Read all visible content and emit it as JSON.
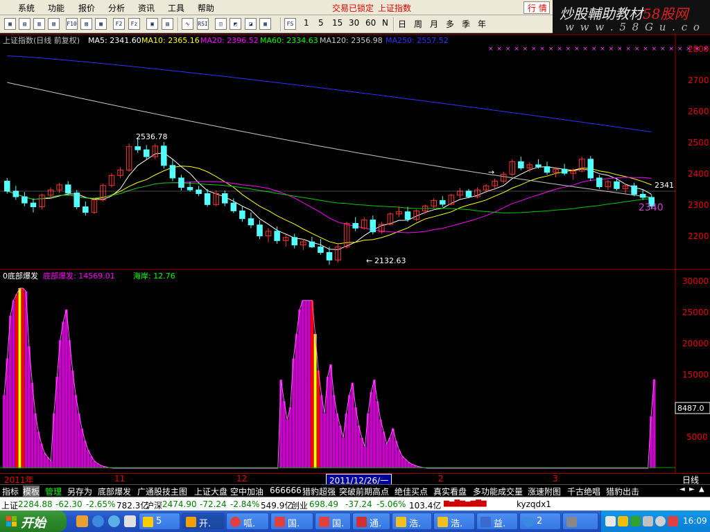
{
  "menu": {
    "items": [
      "系统",
      "功能",
      "报价",
      "分析",
      "资讯",
      "工具",
      "帮助"
    ],
    "status_locked": "交易已锁定",
    "status_index": "上证指数",
    "trade_label": "行 情"
  },
  "logo": {
    "text_main": "炒股輔助教材",
    "text_red": "58股网",
    "url": "w w w . 5 8 G u . c o m"
  },
  "toolbar": {
    "icons": [
      "tb-1",
      "tb-2",
      "tb-3",
      "tb-4",
      "tb-f10",
      "tb-6",
      "tb-7",
      "tb-8",
      "tb-9",
      "tb-10",
      "tb-11",
      "tb-rsi",
      "tb-13",
      "tb-14",
      "tb-15",
      "tb-fs"
    ],
    "icon_labels": [
      "",
      "",
      "",
      "",
      "F10",
      "",
      "",
      "F2",
      "Fz",
      "",
      "",
      "RSI",
      "",
      "",
      "",
      "FS"
    ],
    "periods": [
      "1",
      "5",
      "15",
      "30",
      "60",
      "N",
      "日",
      "周",
      "月",
      "多",
      "季",
      "年"
    ]
  },
  "price_panel": {
    "title": "上证指数(日线 前复权)",
    "ma5_label": "MA5: 2341.60",
    "ma10_label": "MA10: 2365.16",
    "ma20_label": "MA20: 2396.52",
    "ma60_label": "MA60: 2334.63",
    "ma120_label": "MA120: 2356.98",
    "ma250_label": "MA250: 2557.52",
    "high_marker": "2536.78",
    "low_marker": "2132.63",
    "right_marker": "2341",
    "cursor_value": "2340",
    "axis_ticks": [
      "2800",
      "2700",
      "2600",
      "2500",
      "2400",
      "2300",
      "2200"
    ]
  },
  "indicator_panel": {
    "title": "0底部爆发",
    "value_label": "底部爆发: 14569.01",
    "sea_label": "海岸: 12.76",
    "axis_ticks": [
      "30000",
      "25000",
      "20000",
      "15000",
      "5000"
    ],
    "cursor_value": "8487.0"
  },
  "datebar": {
    "labels": [
      "2011年",
      "11",
      "12",
      "2",
      "3"
    ],
    "cursor_date": "2011/12/26/一",
    "period": "日线"
  },
  "formula_tabs": {
    "items": [
      "指标",
      "模板",
      "管理",
      "另存为",
      "底部爆发",
      "广通股技主图",
      "上证大盘",
      "空中加油",
      "666666",
      "猎豹超强",
      "突破前期高点",
      "绝佳买点",
      "真实看盘",
      "多功能成交量",
      "涨速附图",
      "千古绝唱",
      "猎豹出击"
    ]
  },
  "ticker": {
    "sh_label": "上证",
    "sh_value": "2284.88",
    "sh_change": "-62.30",
    "sh_pct": "-2.65%",
    "sh_amount": "782.3亿",
    "hs_label": "沪深",
    "hs_value": "2474.90",
    "hs_change": "-72.24",
    "hs_pct": "-2.84%",
    "hs_amount": "549.9亿",
    "cy_label": "创业",
    "cy_value": "698.49",
    "cy_change": "-37.24",
    "cy_pct": "-5.06%",
    "cy_amount": "103.4亿",
    "ime": "kyzqdx1"
  },
  "taskbar": {
    "start_label": "开始",
    "tasks": [
      "5",
      "开.",
      "呱.",
      "国.",
      "国.",
      "通.",
      "浩.",
      "浩.",
      "益.",
      "2"
    ],
    "clock": "16:09"
  },
  "colors": {
    "up": "#ff3333",
    "down": "#54ffff",
    "ma5": "#ffffff",
    "ma10": "#ffff00",
    "ma20": "#ff00ff",
    "ma60": "#00cc00",
    "ma120": "#c8c8c8",
    "ma250": "#3030ff",
    "hist": "#cc00cc",
    "hist_peak": "#ffff00",
    "hist_peak_red": "#ff0000"
  },
  "chart_data": {
    "type": "candlestick",
    "title": "上证指数(日线 前复权)",
    "ylim": [
      2140,
      2830
    ],
    "x_labels": [
      "2011年",
      "11",
      "12",
      "2011/12/26",
      "2",
      "3"
    ],
    "ma_series": [
      {
        "name": "MA5",
        "last": 2341.6
      },
      {
        "name": "MA10",
        "last": 2365.16
      },
      {
        "name": "MA20",
        "last": 2396.52
      },
      {
        "name": "MA60",
        "last": 2334.63
      },
      {
        "name": "MA120",
        "last": 2356.98
      },
      {
        "name": "MA250",
        "last": 2557.52
      }
    ],
    "ohlc": [
      [
        2400,
        2410,
        2360,
        2368
      ],
      [
        2368,
        2385,
        2340,
        2350
      ],
      [
        2350,
        2365,
        2320,
        2330
      ],
      [
        2330,
        2345,
        2300,
        2318
      ],
      [
        2318,
        2360,
        2310,
        2355
      ],
      [
        2355,
        2380,
        2345,
        2372
      ],
      [
        2372,
        2395,
        2362,
        2388
      ],
      [
        2388,
        2400,
        2355,
        2362
      ],
      [
        2362,
        2372,
        2310,
        2318
      ],
      [
        2318,
        2335,
        2290,
        2300
      ],
      [
        2300,
        2345,
        2295,
        2340
      ],
      [
        2340,
        2392,
        2335,
        2386
      ],
      [
        2386,
        2425,
        2380,
        2418
      ],
      [
        2418,
        2445,
        2410,
        2435
      ],
      [
        2435,
        2520,
        2430,
        2510
      ],
      [
        2510,
        2537,
        2490,
        2500
      ],
      [
        2500,
        2515,
        2470,
        2478
      ],
      [
        2478,
        2520,
        2470,
        2512
      ],
      [
        2512,
        2525,
        2440,
        2450
      ],
      [
        2450,
        2470,
        2400,
        2410
      ],
      [
        2410,
        2420,
        2370,
        2380
      ],
      [
        2380,
        2398,
        2366,
        2372
      ],
      [
        2372,
        2385,
        2352,
        2360
      ],
      [
        2360,
        2375,
        2318,
        2325
      ],
      [
        2325,
        2370,
        2320,
        2360
      ],
      [
        2360,
        2370,
        2320,
        2330
      ],
      [
        2330,
        2345,
        2298,
        2305
      ],
      [
        2305,
        2320,
        2270,
        2280
      ],
      [
        2280,
        2300,
        2250,
        2260
      ],
      [
        2260,
        2275,
        2215,
        2225
      ],
      [
        2225,
        2250,
        2205,
        2240
      ],
      [
        2240,
        2255,
        2200,
        2210
      ],
      [
        2210,
        2230,
        2190,
        2220
      ],
      [
        2220,
        2232,
        2185,
        2196
      ],
      [
        2196,
        2215,
        2180,
        2206
      ],
      [
        2206,
        2222,
        2186,
        2190
      ],
      [
        2190,
        2215,
        2165,
        2172
      ],
      [
        2172,
        2190,
        2133,
        2148
      ],
      [
        2148,
        2200,
        2140,
        2190
      ],
      [
        2190,
        2270,
        2185,
        2265
      ],
      [
        2265,
        2285,
        2240,
        2250
      ],
      [
        2250,
        2285,
        2245,
        2276
      ],
      [
        2276,
        2290,
        2230,
        2238
      ],
      [
        2238,
        2270,
        2232,
        2262
      ],
      [
        2262,
        2300,
        2258,
        2295
      ],
      [
        2295,
        2320,
        2285,
        2302
      ],
      [
        2302,
        2318,
        2270,
        2278
      ],
      [
        2278,
        2310,
        2272,
        2305
      ],
      [
        2305,
        2325,
        2295,
        2320
      ],
      [
        2320,
        2345,
        2312,
        2338
      ],
      [
        2338,
        2352,
        2318,
        2326
      ],
      [
        2326,
        2360,
        2322,
        2355
      ],
      [
        2355,
        2378,
        2345,
        2368
      ],
      [
        2368,
        2375,
        2345,
        2350
      ],
      [
        2350,
        2380,
        2345,
        2372
      ],
      [
        2372,
        2390,
        2362,
        2385
      ],
      [
        2385,
        2408,
        2372,
        2400
      ],
      [
        2400,
        2430,
        2392,
        2422
      ],
      [
        2422,
        2470,
        2415,
        2462
      ],
      [
        2462,
        2478,
        2435,
        2442
      ],
      [
        2442,
        2460,
        2428,
        2452
      ],
      [
        2452,
        2470,
        2440,
        2446
      ],
      [
        2446,
        2462,
        2420,
        2428
      ],
      [
        2428,
        2445,
        2412,
        2438
      ],
      [
        2438,
        2455,
        2418,
        2425
      ],
      [
        2425,
        2440,
        2405,
        2432
      ],
      [
        2432,
        2478,
        2428,
        2470
      ],
      [
        2470,
        2480,
        2400,
        2410
      ],
      [
        2410,
        2420,
        2375,
        2382
      ],
      [
        2382,
        2405,
        2372,
        2398
      ],
      [
        2398,
        2410,
        2370,
        2376
      ],
      [
        2376,
        2392,
        2360,
        2385
      ],
      [
        2385,
        2395,
        2352,
        2358
      ],
      [
        2358,
        2372,
        2340,
        2348
      ],
      [
        2348,
        2356,
        2310,
        2320
      ]
    ],
    "indicator": {
      "name": "底部爆发",
      "last": 14569.01,
      "ylim": [
        0,
        32000
      ],
      "values": [
        12000,
        18000,
        25000,
        27500,
        28500,
        29500,
        29500,
        29000,
        20000,
        14000,
        9000,
        6000,
        4000,
        2500,
        1800,
        1200,
        9000,
        15000,
        21000,
        24000,
        26000,
        21000,
        16000,
        12000,
        9000,
        6500,
        4500,
        3000,
        2000,
        1200,
        800,
        500,
        300,
        200,
        100,
        0,
        0,
        0,
        0,
        0,
        0,
        0,
        0,
        0,
        0,
        0,
        0,
        0,
        0,
        0,
        0,
        0,
        0,
        0,
        0,
        0,
        0,
        0,
        0,
        0,
        0,
        0,
        0,
        0,
        0,
        0,
        0,
        0,
        0,
        0,
        0,
        0,
        0,
        0,
        0,
        0,
        0,
        0,
        0,
        0,
        0,
        0,
        0,
        0,
        0,
        0,
        0,
        0,
        0,
        14500,
        11000,
        8000,
        10000,
        18000,
        22000,
        26000,
        27500,
        27500,
        27500,
        27500,
        22000,
        16000,
        12000,
        9000,
        15000,
        17000,
        12000,
        9000,
        7000,
        5000,
        9000,
        12000,
        14000,
        10000,
        7000,
        5000,
        3500,
        9000,
        12500,
        14500,
        11000,
        8000,
        6000,
        4000,
        5000,
        6500,
        4500,
        3000,
        2000,
        1500,
        1000,
        700,
        500,
        300,
        200,
        100,
        0,
        0,
        0,
        0,
        0,
        0,
        0,
        0,
        0,
        0,
        0,
        0,
        0,
        0,
        0,
        0,
        0,
        0,
        0,
        0,
        0,
        0,
        0,
        0,
        0,
        0,
        0,
        0,
        0,
        0,
        0,
        0,
        0,
        0,
        0,
        0,
        0,
        0,
        0,
        0,
        0,
        0,
        0,
        0,
        0,
        0,
        0,
        0,
        0,
        0,
        0,
        0,
        0,
        0,
        0,
        0,
        0,
        0,
        0,
        0,
        0,
        0,
        0,
        0,
        0,
        0,
        0,
        0,
        0,
        0,
        0,
        0,
        8500,
        14569
      ],
      "peaks_yellow": [
        5,
        100
      ],
      "peaks_red": [
        4,
        6,
        99,
        101
      ]
    }
  }
}
